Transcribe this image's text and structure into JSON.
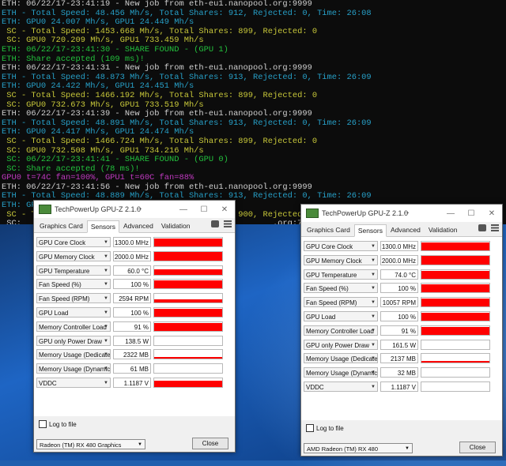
{
  "console": {
    "lines": [
      {
        "text": "ETH: 06/22/17-23:41:19 - New job from eth-eu1.nanopool.org:9999",
        "color": "white"
      },
      {
        "text": "ETH - Total Speed: 48.456 Mh/s, Total Shares: 912, Rejected: 0, Time: 26:08",
        "color": "cyan"
      },
      {
        "text": "ETH: GPU0 24.007 Mh/s, GPU1 24.449 Mh/s",
        "color": "cyan"
      },
      {
        "text": " SC - Total Speed: 1453.668 Mh/s, Total Shares: 899, Rejected: 0",
        "color": "yellow"
      },
      {
        "text": " SC: GPU0 720.209 Mh/s, GPU1 733.459 Mh/s",
        "color": "yellow"
      },
      {
        "text": "ETH: 06/22/17-23:41:30 - SHARE FOUND - (GPU 1)",
        "color": "green"
      },
      {
        "text": "ETH: Share accepted (109 ms)!",
        "color": "green"
      },
      {
        "text": "ETH: 06/22/17-23:41:31 - New job from eth-eu1.nanopool.org:9999",
        "color": "white"
      },
      {
        "text": "ETH - Total Speed: 48.873 Mh/s, Total Shares: 913, Rejected: 0, Time: 26:09",
        "color": "cyan"
      },
      {
        "text": "ETH: GPU0 24.422 Mh/s, GPU1 24.451 Mh/s",
        "color": "cyan"
      },
      {
        "text": " SC - Total Speed: 1466.192 Mh/s, Total Shares: 899, Rejected: 0",
        "color": "yellow"
      },
      {
        "text": " SC: GPU0 732.673 Mh/s, GPU1 733.519 Mh/s",
        "color": "yellow"
      },
      {
        "text": "ETH: 06/22/17-23:41:39 - New job from eth-eu1.nanopool.org:9999",
        "color": "white"
      },
      {
        "text": "ETH - Total Speed: 48.891 Mh/s, Total Shares: 913, Rejected: 0, Time: 26:09",
        "color": "cyan"
      },
      {
        "text": "ETH: GPU0 24.417 Mh/s, GPU1 24.474 Mh/s",
        "color": "cyan"
      },
      {
        "text": " SC - Total Speed: 1466.724 Mh/s, Total Shares: 899, Rejected: 0",
        "color": "yellow"
      },
      {
        "text": " SC: GPU0 732.508 Mh/s, GPU1 734.216 Mh/s",
        "color": "yellow"
      },
      {
        "text": " SC: 06/22/17-23:41:41 - SHARE FOUND - (GPU 0)",
        "color": "green"
      },
      {
        "text": " SC: Share accepted (78 ms)!",
        "color": "green"
      },
      {
        "text": "GPU0 t=74C fan=100%, GPU1 t=60C fan=88%",
        "color": "magenta"
      },
      {
        "text": "ETH: 06/22/17-23:41:56 - New job from eth-eu1.nanopool.org:9999",
        "color": "white"
      },
      {
        "text": "ETH - Total Speed: 48.889 Mh/s, Total Shares: 913, Rejected: 0, Time: 26:09",
        "color": "cyan"
      },
      {
        "text": "ETH: GPU0 24.427 Mh/s, GPU1 24.462 Mh/s",
        "color": "cyan"
      },
      {
        "text": " SC - Total Speed: 1466.670 Mh/s, Total Shares: 900, Rejected: 0",
        "color": "yellow"
      },
      {
        "text": " SC:                                                   .org:7777",
        "color": "white"
      },
      {
        "text": "GPU0 t=",
        "color": "magenta"
      }
    ]
  },
  "gpuz_left": {
    "title": "TechPowerUp GPU-Z 2.1.0",
    "tabs": [
      "Graphics Card",
      "Sensors",
      "Advanced",
      "Validation"
    ],
    "active_tab": "Sensors",
    "sensors": [
      {
        "label": "GPU Core Clock",
        "value": "1300.0 MHz",
        "level": 0.95
      },
      {
        "label": "GPU Memory Clock",
        "value": "2000.0 MHz",
        "level": 0.95
      },
      {
        "label": "GPU Temperature",
        "value": "60.0 °C",
        "level": 0.6
      },
      {
        "label": "Fan Speed (%)",
        "value": "100 %",
        "level": 0.95
      },
      {
        "label": "Fan Speed (RPM)",
        "value": "2594 RPM",
        "level": 0.35
      },
      {
        "label": "GPU Load",
        "value": "100 %",
        "level": 0.95
      },
      {
        "label": "Memory Controller Load",
        "value": "91 %",
        "level": 0.9
      },
      {
        "label": "GPU only Power Draw",
        "value": "138.5 W",
        "level": 0.0
      },
      {
        "label": "Memory Usage (Dedicated)",
        "value": "2322 MB",
        "level": 0.25
      },
      {
        "label": "Memory Usage (Dynamic)",
        "value": "61 MB",
        "level": 0.0
      },
      {
        "label": "VDDC",
        "value": "1.1187 V",
        "level": 0.75
      }
    ],
    "log_label": "Log to file",
    "device": "Radeon (TM) RX 480 Graphics",
    "close_label": "Close"
  },
  "gpuz_right": {
    "title": "TechPowerUp GPU-Z 2.1.0",
    "tabs": [
      "Graphics Card",
      "Sensors",
      "Advanced",
      "Validation"
    ],
    "active_tab": "Sensors",
    "sensors": [
      {
        "label": "GPU Core Clock",
        "value": "1300.0 MHz",
        "level": 0.95
      },
      {
        "label": "GPU Memory Clock",
        "value": "2000.0 MHz",
        "level": 0.95
      },
      {
        "label": "GPU Temperature",
        "value": "74.0 °C",
        "level": 0.9
      },
      {
        "label": "Fan Speed (%)",
        "value": "100 %",
        "level": 0.95
      },
      {
        "label": "Fan Speed (RPM)",
        "value": "10057 RPM",
        "level": 0.95
      },
      {
        "label": "GPU Load",
        "value": "100 %",
        "level": 0.95
      },
      {
        "label": "Memory Controller Load",
        "value": "91 %",
        "level": 0.9
      },
      {
        "label": "GPU only Power Draw",
        "value": "161.5 W",
        "level": 0.0
      },
      {
        "label": "Memory Usage (Dedicated)",
        "value": "2137 MB",
        "level": 0.25
      },
      {
        "label": "Memory Usage (Dynamic)",
        "value": "32 MB",
        "level": 0.0
      },
      {
        "label": "VDDC",
        "value": "1.1187 V",
        "level": 0.0
      }
    ],
    "log_label": "Log to file",
    "device": "AMD Radeon (TM) RX 480",
    "close_label": "Close"
  },
  "colors": {
    "white": "#d0d0d0",
    "cyan": "#27a0c8",
    "yellow": "#c8c83a",
    "green": "#23c23d",
    "magenta": "#c03ac0",
    "graph_fill": "#ff0000"
  }
}
